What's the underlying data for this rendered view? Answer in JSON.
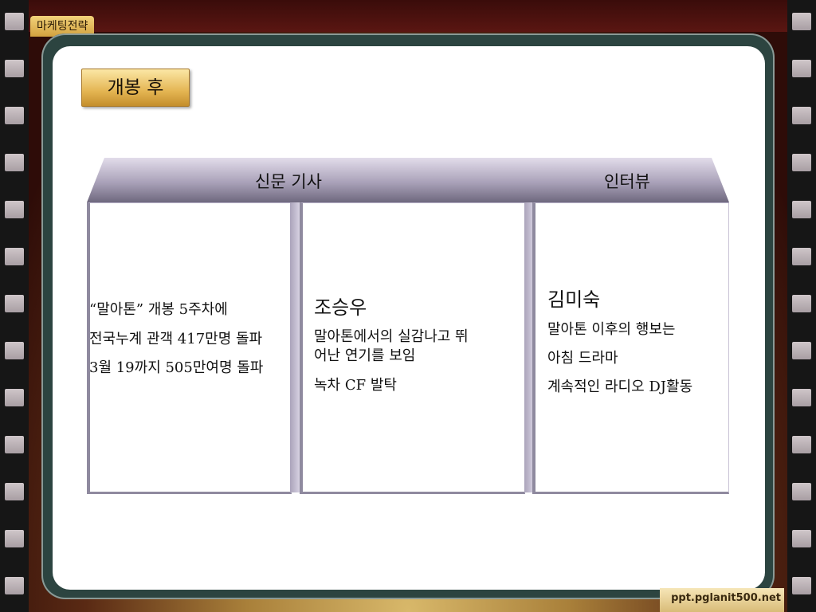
{
  "section_tag": "마케팅전략",
  "title": "개봉 후",
  "headers": {
    "news": "신문 기사",
    "interview": "인터뷰"
  },
  "news": {
    "line1": "“말아톤” 개봉 5주차에",
    "line2": "전국누계 관객 417만명 돌파",
    "line3": "3월 19까지 505만여명 돌파"
  },
  "actor": {
    "name": "조승우",
    "line1": "말아톤에서의 실감나고 뛰",
    "line2": "어난 연기를 보임",
    "line3": "녹차 CF 발탁"
  },
  "interview": {
    "name": "김미숙",
    "line1": "말아톤 이후의 행보는",
    "line2": "아침 드라마",
    "line3": "계속적인 라디오 DJ활동"
  },
  "footer": "ppt.pglanit500.net",
  "colors": {
    "frame": "#2c4440",
    "badge": "#e4b552",
    "header_band": "#8f889e"
  }
}
